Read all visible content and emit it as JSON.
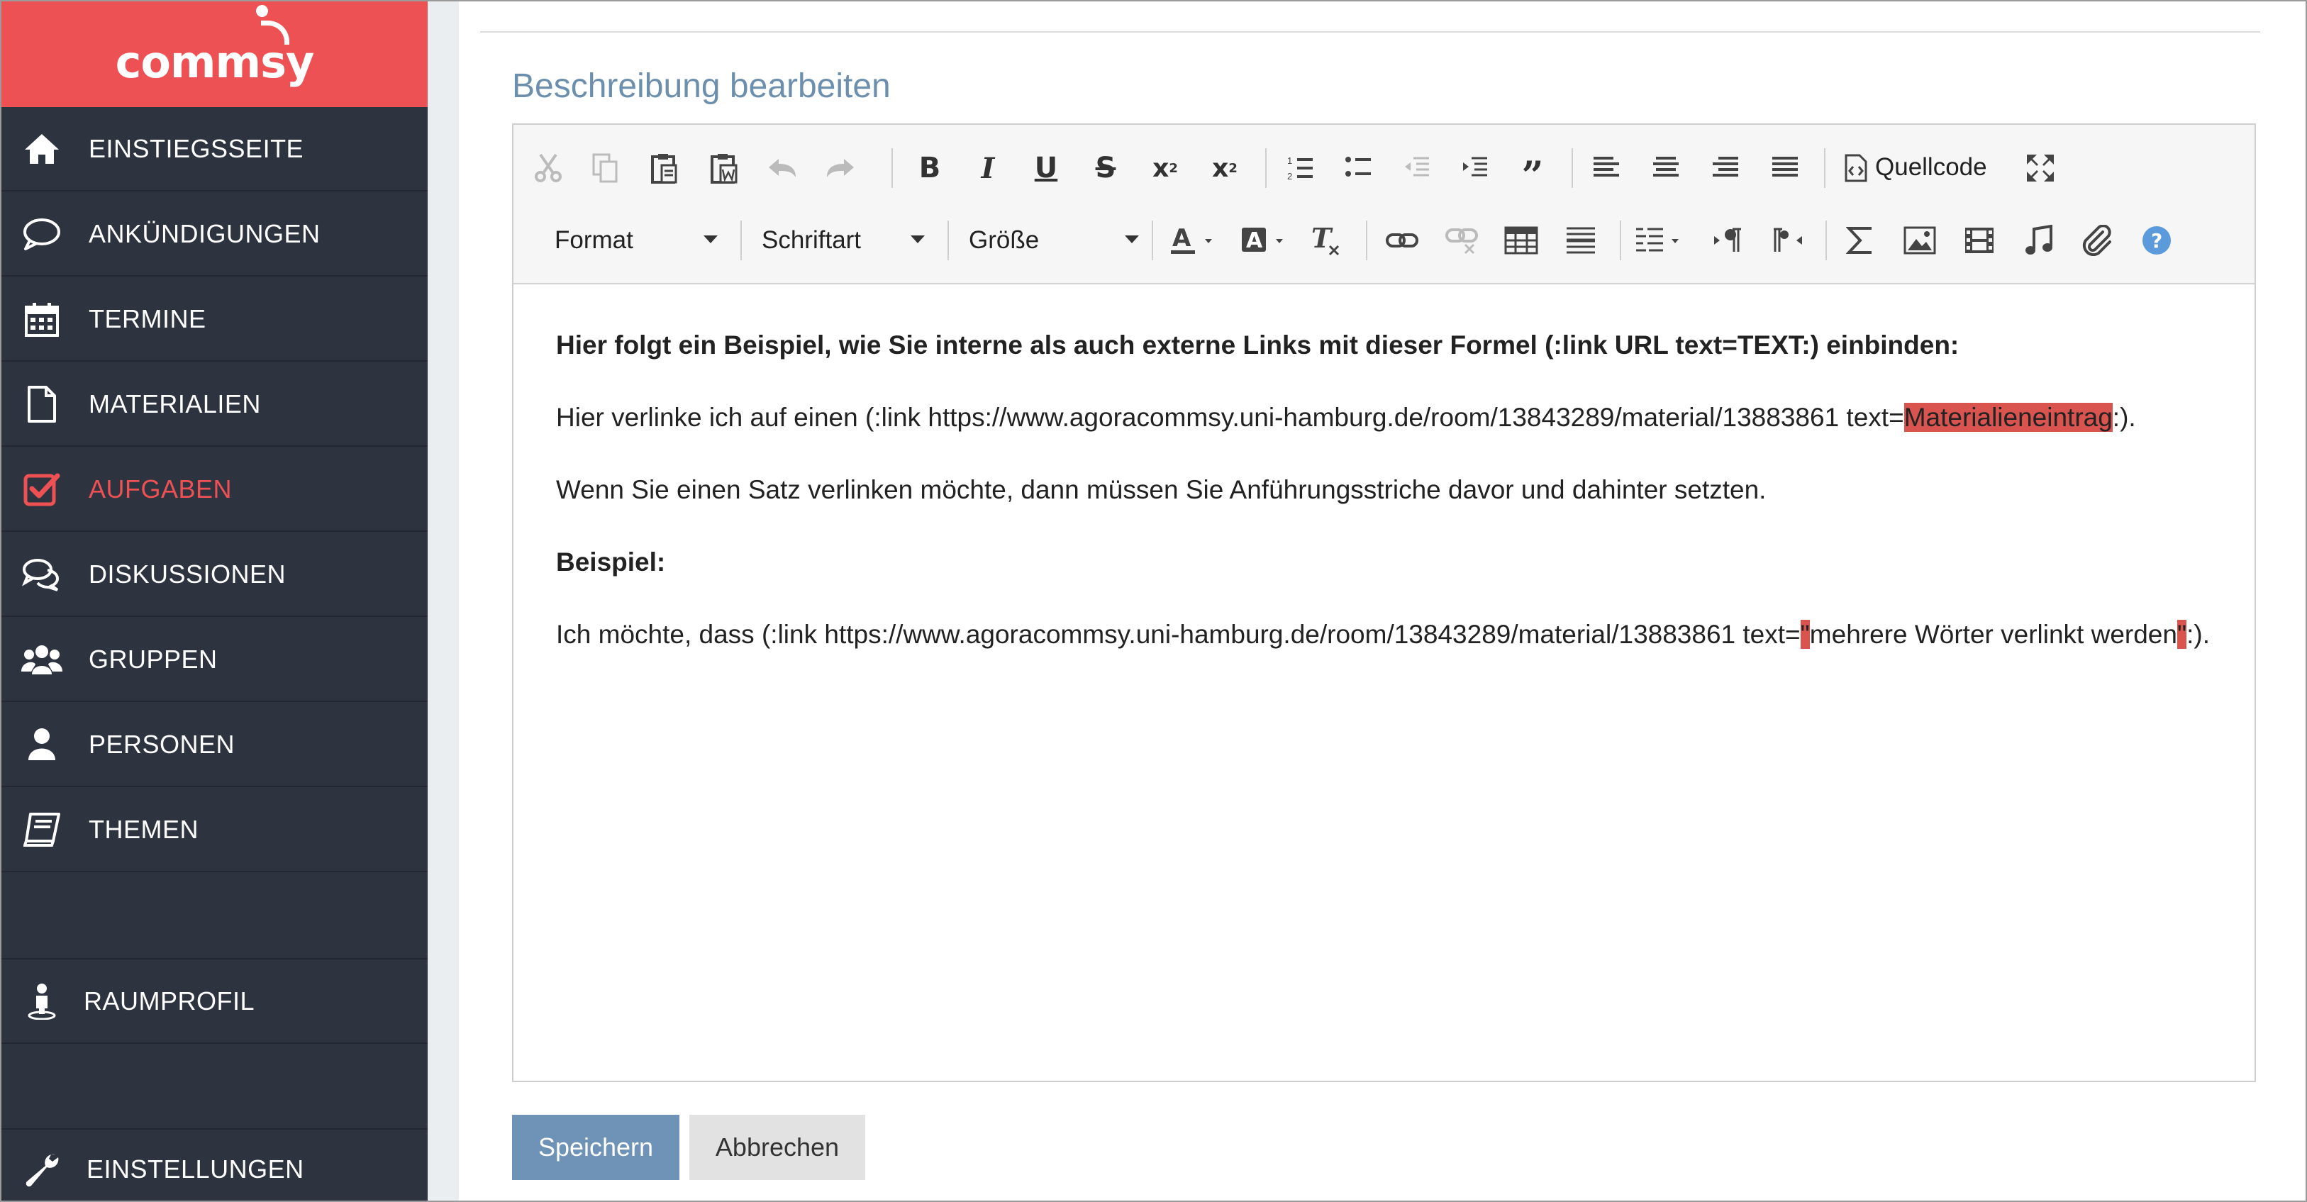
{
  "brand": {
    "logo_text": "commsy",
    "accent": "#ed5153",
    "sidebar_bg": "#2e3340"
  },
  "sidebar": {
    "items": [
      {
        "label": "EINSTIEGSSEITE",
        "icon": "home-icon"
      },
      {
        "label": "ANKÜNDIGUNGEN",
        "icon": "speech-bubble-icon"
      },
      {
        "label": "TERMINE",
        "icon": "calendar-icon"
      },
      {
        "label": "MATERIALIEN",
        "icon": "document-icon"
      },
      {
        "label": "AUFGABEN",
        "icon": "checkbox-icon",
        "active": true
      },
      {
        "label": "DISKUSSIONEN",
        "icon": "chat-bubbles-icon"
      },
      {
        "label": "GRUPPEN",
        "icon": "group-icon"
      },
      {
        "label": "PERSONEN",
        "icon": "person-icon"
      },
      {
        "label": "THEMEN",
        "icon": "book-icon"
      },
      {
        "label": "RAUMPROFIL",
        "icon": "room-profile-icon"
      },
      {
        "label": "EINSTELLUNGEN",
        "icon": "wrench-icon"
      }
    ]
  },
  "main": {
    "title": "Beschreibung bearbeiten",
    "toolbar": {
      "source_label": "Quellcode",
      "format_label": "Format",
      "font_label": "Schriftart",
      "size_label": "Größe"
    },
    "content": {
      "p1": "Hier folgt ein Beispiel, wie Sie interne als auch externe Links mit dieser Formel (:link URL text=TEXT:) einbinden:",
      "p2_before": "Hier verlinke ich auf einen (:link https://www.agoracommsy.uni-hamburg.de/room/13843289/material/13883861 text=",
      "p2_highlight": "Materialieneintrag",
      "p2_after": ":).",
      "p3": "Wenn Sie einen Satz verlinken möchte, dann müssen Sie Anführungsstriche davor und dahinter setzten.",
      "p4": "Beispiel:",
      "p5_before": "Ich möchte, dass (:link https://www.agoracommsy.uni-hamburg.de/room/13843289/material/13883861 text=",
      "p5_quote1": "\"",
      "p5_middle": "mehrere Wörter verlinkt werden",
      "p5_quote2": "\"",
      "p5_after": ":)."
    },
    "buttons": {
      "save": "Speichern",
      "cancel": "Abbrechen"
    }
  }
}
